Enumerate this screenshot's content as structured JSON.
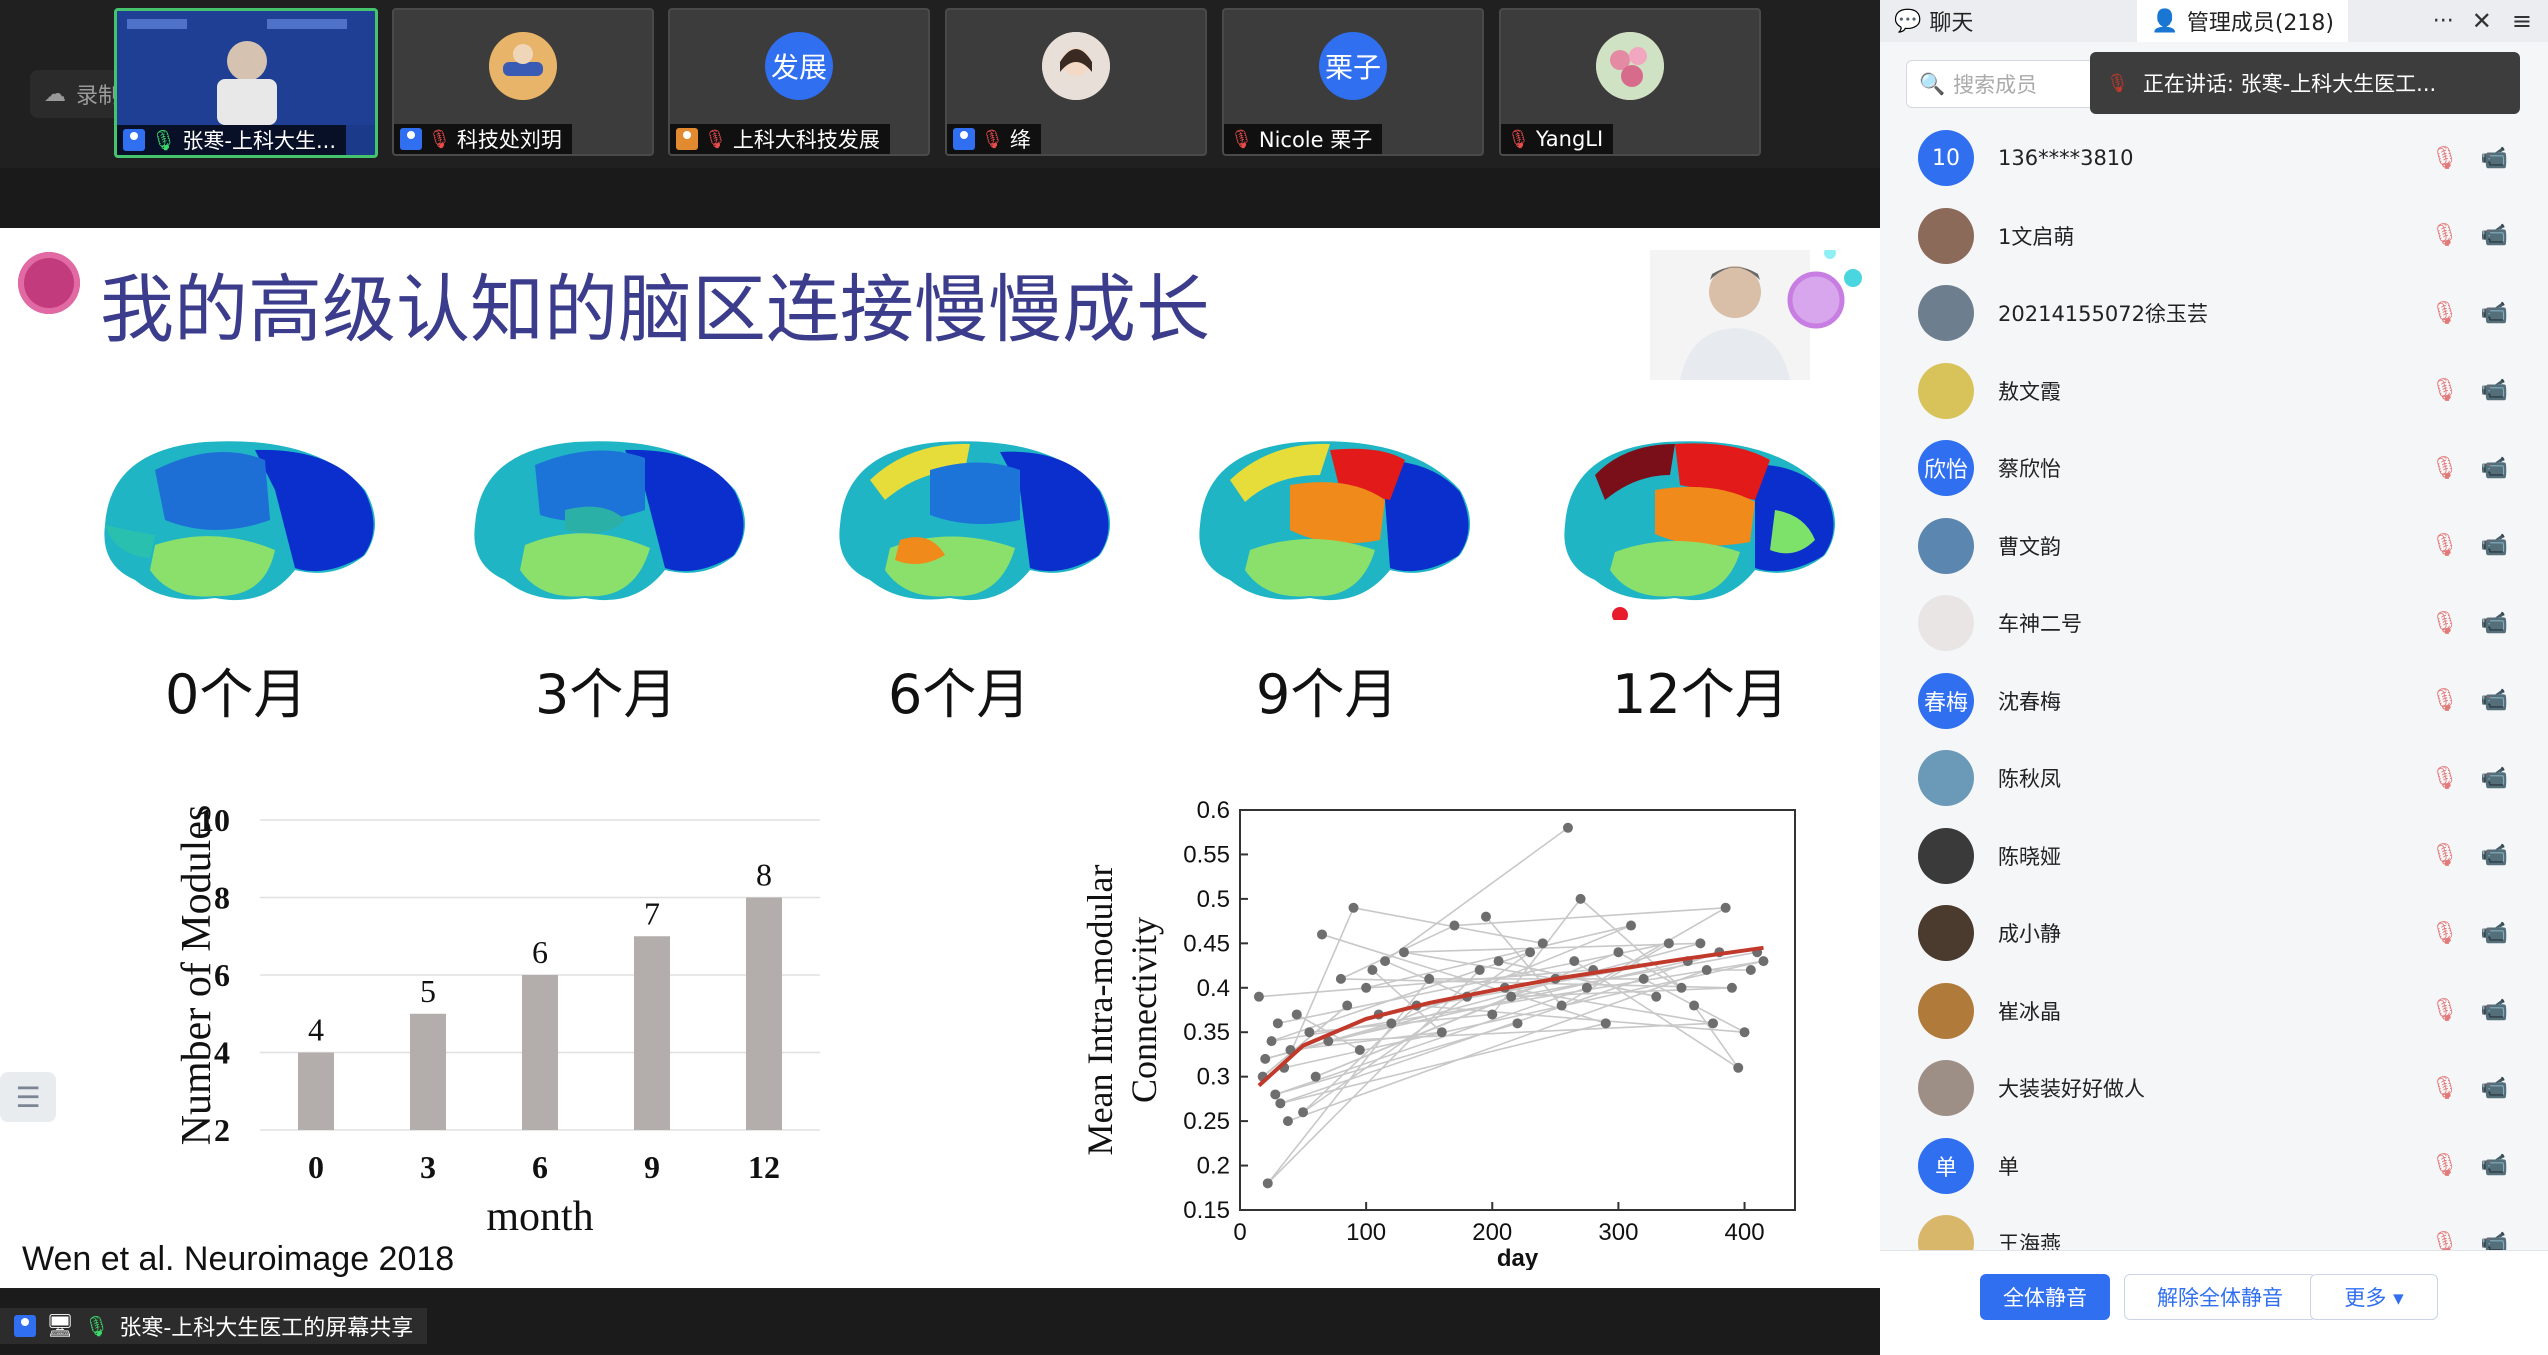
{
  "recording_label": "录制中",
  "tiles": [
    {
      "name": "张寒-上科大生...",
      "avatar": "",
      "active": true,
      "mic": "on"
    },
    {
      "name": "科技处刘玥",
      "avatar": "",
      "active": false,
      "mic": "muted"
    },
    {
      "name": "上科大科技发展",
      "avatar": "发展",
      "active": false,
      "mic": "muted"
    },
    {
      "name": "绛",
      "avatar": "",
      "active": false,
      "mic": "muted"
    },
    {
      "name": "Nicole 栗子",
      "avatar": "栗子",
      "active": false,
      "mic": "muted"
    },
    {
      "name": "YangLI",
      "avatar": "",
      "active": false,
      "mic": "muted"
    }
  ],
  "slide": {
    "title": "我的高级认知的脑区连接慢慢成长",
    "brain_labels": [
      "0个月",
      "3个月",
      "6个月",
      "9个月",
      "12个月"
    ],
    "citation": "Wen et al. Neuroimage 2018"
  },
  "chart_data": [
    {
      "type": "bar",
      "categories": [
        "0",
        "3",
        "6",
        "9",
        "12"
      ],
      "values": [
        4,
        5,
        6,
        7,
        8
      ],
      "data_labels": [
        "4",
        "5",
        "6",
        "7",
        "8"
      ],
      "xlabel": "month",
      "ylabel": "Number of Modules",
      "ylim": [
        2,
        10
      ],
      "yticks": [
        "2",
        "4",
        "6",
        "8",
        "10"
      ],
      "bar_color": "#b3aeac"
    },
    {
      "type": "scatter",
      "xlabel": "day",
      "ylabel": "Mean Intra-modular Connectivity",
      "xlim": [
        0,
        440
      ],
      "ylim": [
        0.15,
        0.6
      ],
      "xticks": [
        "0",
        "100",
        "200",
        "300",
        "400"
      ],
      "yticks": [
        "0.15",
        "0.2",
        "0.25",
        "0.3",
        "0.35",
        "0.4",
        "0.45",
        "0.5",
        "0.55",
        "0.6"
      ],
      "fit_curve": {
        "x": [
          15,
          50,
          100,
          150,
          200,
          250,
          300,
          350,
          415
        ],
        "y": [
          0.29,
          0.335,
          0.365,
          0.383,
          0.397,
          0.41,
          0.421,
          0.432,
          0.445
        ],
        "color": "#c0392b"
      },
      "points": {
        "x": [
          15,
          18,
          20,
          22,
          25,
          28,
          30,
          32,
          35,
          38,
          40,
          45,
          50,
          55,
          60,
          65,
          70,
          80,
          85,
          90,
          95,
          100,
          105,
          110,
          115,
          120,
          130,
          140,
          150,
          160,
          170,
          180,
          190,
          195,
          200,
          205,
          210,
          215,
          220,
          230,
          240,
          250,
          255,
          260,
          265,
          270,
          275,
          280,
          290,
          300,
          310,
          320,
          330,
          340,
          350,
          355,
          360,
          365,
          370,
          375,
          380,
          385,
          390,
          395,
          400,
          405,
          410,
          415
        ],
        "y": [
          0.39,
          0.3,
          0.32,
          0.18,
          0.34,
          0.28,
          0.36,
          0.27,
          0.31,
          0.25,
          0.33,
          0.37,
          0.26,
          0.35,
          0.3,
          0.46,
          0.34,
          0.41,
          0.38,
          0.49,
          0.33,
          0.4,
          0.42,
          0.37,
          0.43,
          0.36,
          0.44,
          0.38,
          0.41,
          0.35,
          0.47,
          0.39,
          0.42,
          0.48,
          0.37,
          0.43,
          0.4,
          0.39,
          0.36,
          0.44,
          0.45,
          0.41,
          0.38,
          0.58,
          0.43,
          0.5,
          0.4,
          0.42,
          0.36,
          0.44,
          0.47,
          0.41,
          0.39,
          0.45,
          0.4,
          0.43,
          0.38,
          0.45,
          0.42,
          0.36,
          0.44,
          0.49,
          0.4,
          0.31,
          0.35,
          0.42,
          0.44,
          0.43
        ]
      },
      "point_color": "#6e6e6e",
      "line_color": "#c8c8c8"
    }
  ],
  "panel": {
    "tab_chat": "聊天",
    "tab_members": "管理成员(218)",
    "more_icon": "···",
    "search_placeholder": "搜索成员",
    "speaking": "正在讲话: 张寒-上科大生医工...",
    "members": [
      {
        "name": "136****3810",
        "avatar_text": "10",
        "color": "#2f6ff0"
      },
      {
        "name": "1文启萌",
        "avatar_text": "",
        "color": "#8b6a5a"
      },
      {
        "name": "20214155072徐玉芸",
        "avatar_text": "",
        "color": "#6d7f8f"
      },
      {
        "name": "敖文霞",
        "avatar_text": "",
        "color": "#d8c35a"
      },
      {
        "name": "蔡欣怡",
        "avatar_text": "欣怡",
        "color": "#2f6ff0"
      },
      {
        "name": "曹文韵",
        "avatar_text": "",
        "color": "#5b86b0"
      },
      {
        "name": "车神二号",
        "avatar_text": "",
        "color": "#e9e5e5"
      },
      {
        "name": "沈春梅",
        "avatar_text": "春梅",
        "color": "#2f6ff0"
      },
      {
        "name": "陈秋凤",
        "avatar_text": "",
        "color": "#6a9ab8"
      },
      {
        "name": "陈晓娅",
        "avatar_text": "",
        "color": "#3a3a3a"
      },
      {
        "name": "成小静",
        "avatar_text": "",
        "color": "#4b3a2e"
      },
      {
        "name": "崔冰晶",
        "avatar_text": "",
        "color": "#b07a3a"
      },
      {
        "name": "大装装好好做人",
        "avatar_text": "",
        "color": "#9d8f86"
      },
      {
        "name": "单",
        "avatar_text": "单",
        "color": "#2f6ff0"
      },
      {
        "name": "王海燕",
        "avatar_text": "",
        "color": "#d9b76a"
      }
    ],
    "mute_all": "全体静音",
    "unmute_all": "解除全体静音",
    "more": "更多 ▾"
  },
  "share_label": "张寒-上科大生医工的屏幕共享"
}
